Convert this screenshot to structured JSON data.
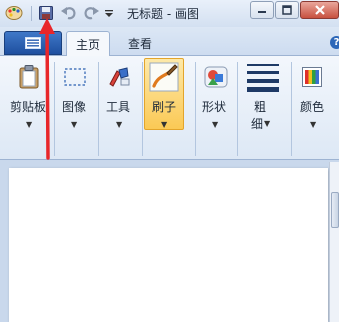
{
  "window": {
    "title": "无标题 - 画图"
  },
  "quick_access": {
    "icons": [
      "paint-app-icon",
      "save-icon",
      "undo-icon",
      "redo-icon",
      "customize-dropdown-icon"
    ]
  },
  "ribbon_tabs": {
    "home": "主页",
    "view": "查看"
  },
  "ribbon_groups": {
    "clipboard": "剪贴板",
    "image": "图像",
    "tools": "工具",
    "brushes": "刷子",
    "shapes": "形状",
    "size_line1": "粗",
    "size_line2": "细",
    "colors": "颜色"
  },
  "colors": {
    "brush_highlight": "#fbc955",
    "annotation_arrow": "#e8262a",
    "app_menu": "#2a5fb0"
  }
}
